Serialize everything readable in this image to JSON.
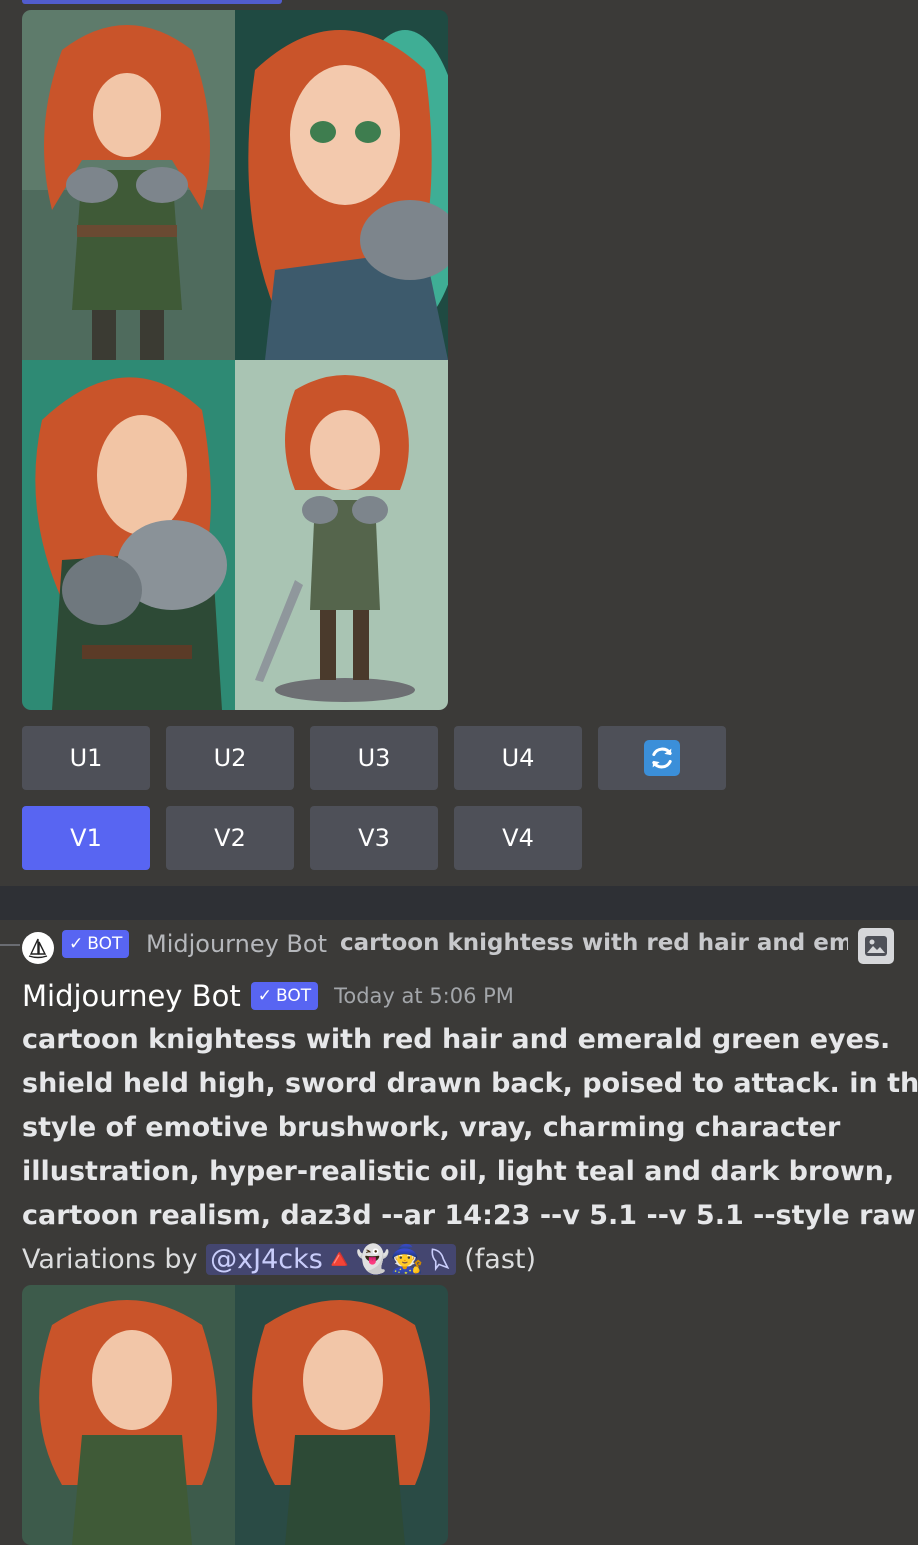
{
  "buttons": {
    "upscale": [
      "U1",
      "U2",
      "U3",
      "U4"
    ],
    "variation": [
      "V1",
      "V2",
      "V3",
      "V4"
    ],
    "active": "V1",
    "reroll_icon": "refresh-icon"
  },
  "reply": {
    "badge": "BOT",
    "name": "Midjourney Bot",
    "preview": "cartoon knightess with red hair and emerald green eyes. shield held high, sword drawn back, poised to attack.",
    "image_icon": "image-icon"
  },
  "message": {
    "author": "Midjourney Bot",
    "badge": "BOT",
    "timestamp": "Today at 5:06 PM",
    "prompt_lines": [
      "cartoon knightess with red hair and emerald green eyes.",
      "shield held high, sword drawn back, poised to attack. in the",
      "style of emotive brushwork, vray, charming character",
      "illustration, hyper-realistic oil, light teal and dark brown,",
      "cartoon realism, daz3d --ar 14:23 --v 5.1 --v 5.1 --style raw"
    ],
    "dash": " -",
    "prefix": "Variations by ",
    "mention": "@xJ4cks🔺👻🧙",
    "suffix": " (fast)"
  },
  "colors": {
    "background": "#3b3a38",
    "button": "#4e5058",
    "accent": "#5865f2",
    "hair": "#c9542a",
    "teal": "#3fae95",
    "armor": "#7d858c"
  }
}
